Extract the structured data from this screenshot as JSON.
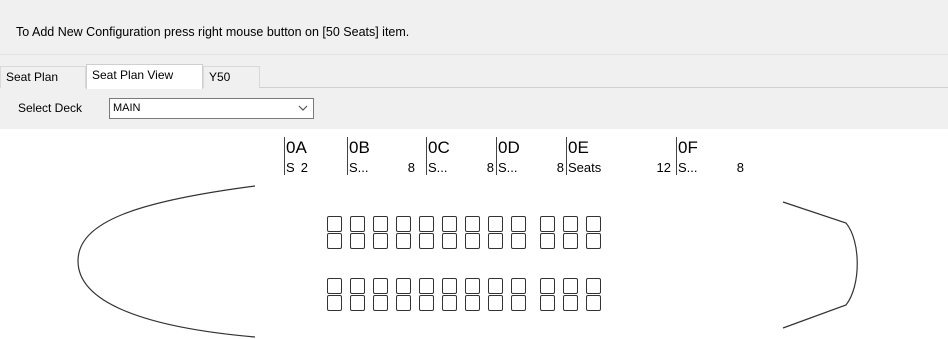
{
  "info": {
    "text": "To Add New Configuration press right mouse button on [50 Seats] item."
  },
  "tabs": [
    {
      "label": "Seat Plan",
      "active": false
    },
    {
      "label": "Seat Plan View",
      "active": true
    },
    {
      "label": "Y50",
      "active": false
    }
  ],
  "deck": {
    "label": "Select Deck",
    "value": "MAIN",
    "dropdown_icon": "chevron-down-icon"
  },
  "seat_columns": [
    {
      "code": "0A",
      "sub": "S",
      "count": "2"
    },
    {
      "code": "0B",
      "sub": "S...",
      "count": "8"
    },
    {
      "code": "0C",
      "sub": "S...",
      "count": "8"
    },
    {
      "code": "0D",
      "sub": "S...",
      "count": "8"
    },
    {
      "code": "0E",
      "sub": "Seats",
      "count": "12"
    },
    {
      "code": "0F",
      "sub": "S...",
      "count": "8"
    }
  ],
  "seat_map": {
    "seats_per_row": 12,
    "rows": 4
  },
  "colors": {
    "background": "#f0f0f0",
    "canvas": "#ffffff",
    "outline": "#333333"
  }
}
